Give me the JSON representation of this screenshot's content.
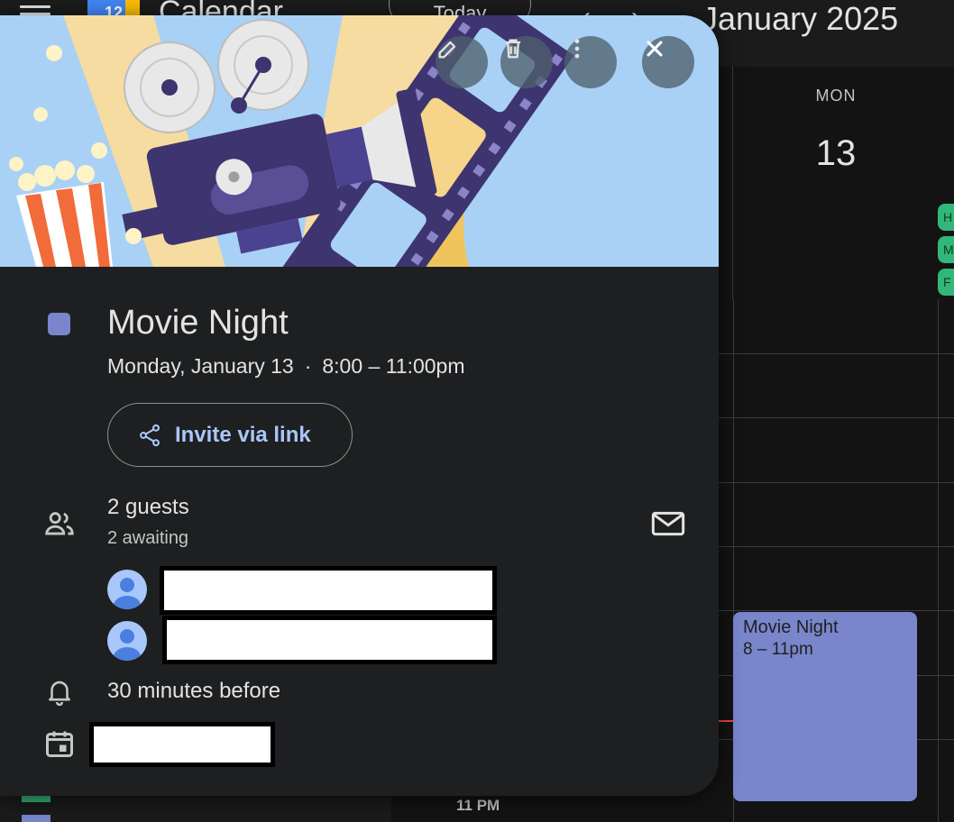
{
  "app": {
    "title": "Calendar",
    "logo_day": "12",
    "today_label": "Today",
    "prev_icon": "‹",
    "next_icon": "›",
    "month_title": "January 2025"
  },
  "day_column": {
    "weekday": "MON",
    "date": "13",
    "chips": [
      "H",
      "M",
      "F"
    ]
  },
  "time_label": "11 PM",
  "calendar_event_block": {
    "title": "Movie Night",
    "time": "8 – 11pm",
    "color": "#7986cb"
  },
  "popup": {
    "actions": [
      "edit-icon",
      "delete-icon",
      "more-options-icon",
      "close-icon"
    ],
    "event": {
      "title": "Movie Night",
      "date": "Monday, January 13",
      "separator": "·",
      "time": "8:00 – 11:00pm",
      "color": "#7986cb"
    },
    "invite_label": "Invite via link",
    "guests": {
      "count": "2 guests",
      "status": "2 awaiting"
    },
    "reminder": "30 minutes before"
  }
}
